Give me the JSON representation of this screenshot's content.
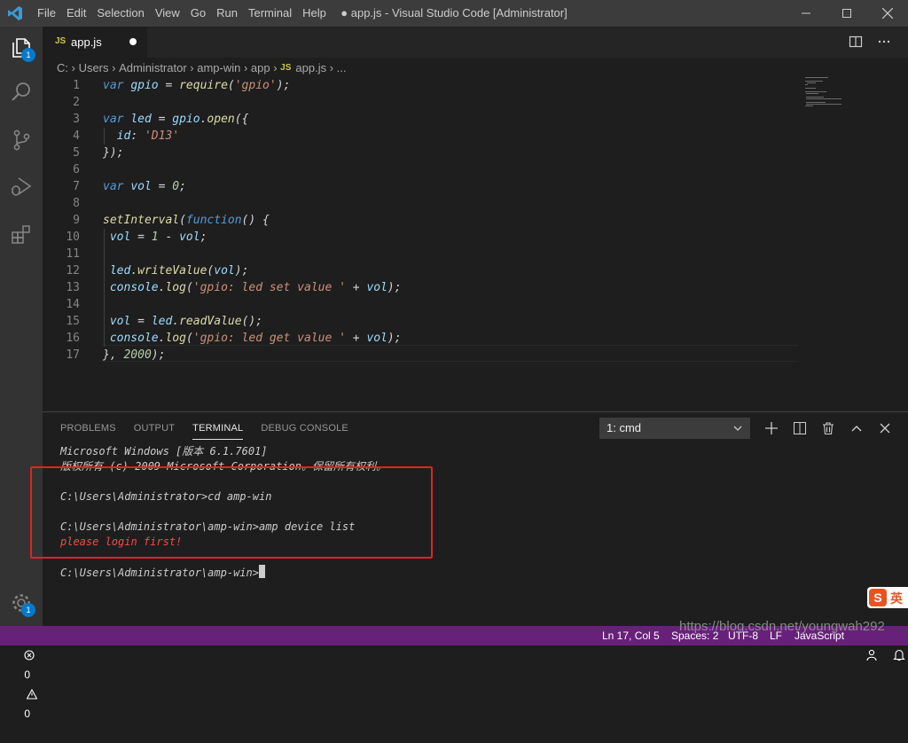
{
  "titlebar": {
    "menu": [
      "File",
      "Edit",
      "Selection",
      "View",
      "Go",
      "Run",
      "Terminal",
      "Help"
    ],
    "title": "● app.js - Visual Studio Code [Administrator]"
  },
  "activity_bar": {
    "explorer_badge": "1",
    "settings_badge": "1"
  },
  "tab": {
    "icon_label": "JS",
    "filename": "app.js"
  },
  "breadcrumb": [
    "C:",
    "Users",
    "Administrator",
    "amp-win",
    "app",
    "JS",
    "app.js",
    "..."
  ],
  "editor": {
    "lines": [
      {
        "n": "1",
        "code": "var gpio = require('gpio');"
      },
      {
        "n": "2",
        "code": ""
      },
      {
        "n": "3",
        "code": "var led = gpio.open({"
      },
      {
        "n": "4",
        "code": "  id: 'D13'"
      },
      {
        "n": "5",
        "code": "});"
      },
      {
        "n": "6",
        "code": ""
      },
      {
        "n": "7",
        "code": "var vol = 0;"
      },
      {
        "n": "8",
        "code": ""
      },
      {
        "n": "9",
        "code": "setInterval(function() {"
      },
      {
        "n": "10",
        "code": " vol = 1 - vol;"
      },
      {
        "n": "11",
        "code": ""
      },
      {
        "n": "12",
        "code": " led.writeValue(vol);"
      },
      {
        "n": "13",
        "code": " console.log('gpio: led set value ' + vol);"
      },
      {
        "n": "14",
        "code": ""
      },
      {
        "n": "15",
        "code": " vol = led.readValue();"
      },
      {
        "n": "16",
        "code": " console.log('gpio: led get value ' + vol);"
      },
      {
        "n": "17",
        "code": "}, 2000);"
      }
    ]
  },
  "panel": {
    "tabs": [
      "PROBLEMS",
      "OUTPUT",
      "TERMINAL",
      "DEBUG CONSOLE"
    ],
    "active_tab": "TERMINAL",
    "terminal_select": "1: cmd",
    "terminal_lines": [
      "Microsoft Windows [版本 6.1.7601]",
      "版权所有 (c) 2009 Microsoft Corporation。保留所有权利。",
      "",
      "C:\\Users\\Administrator>cd amp-win",
      "",
      "C:\\Users\\Administrator\\amp-win>amp device list",
      "please login first!",
      "",
      "C:\\Users\\Administrator\\amp-win>"
    ]
  },
  "statusbar": {
    "errors": "0",
    "warnings": "0",
    "position": "Ln 17, Col 5",
    "spaces": "Spaces: 2",
    "encoding": "UTF-8",
    "eol": "LF",
    "language": "JavaScript"
  },
  "watermark": "https://blog.csdn.net/youngwah292",
  "ime_label": "英",
  "colors": {
    "keyword": "#569cd6",
    "string": "#ce9178",
    "function": "#dcdcaa",
    "variable": "#9cdcfe",
    "number": "#b5cea8",
    "error_text": "#f14c4c",
    "statusbar": "#68217a"
  }
}
